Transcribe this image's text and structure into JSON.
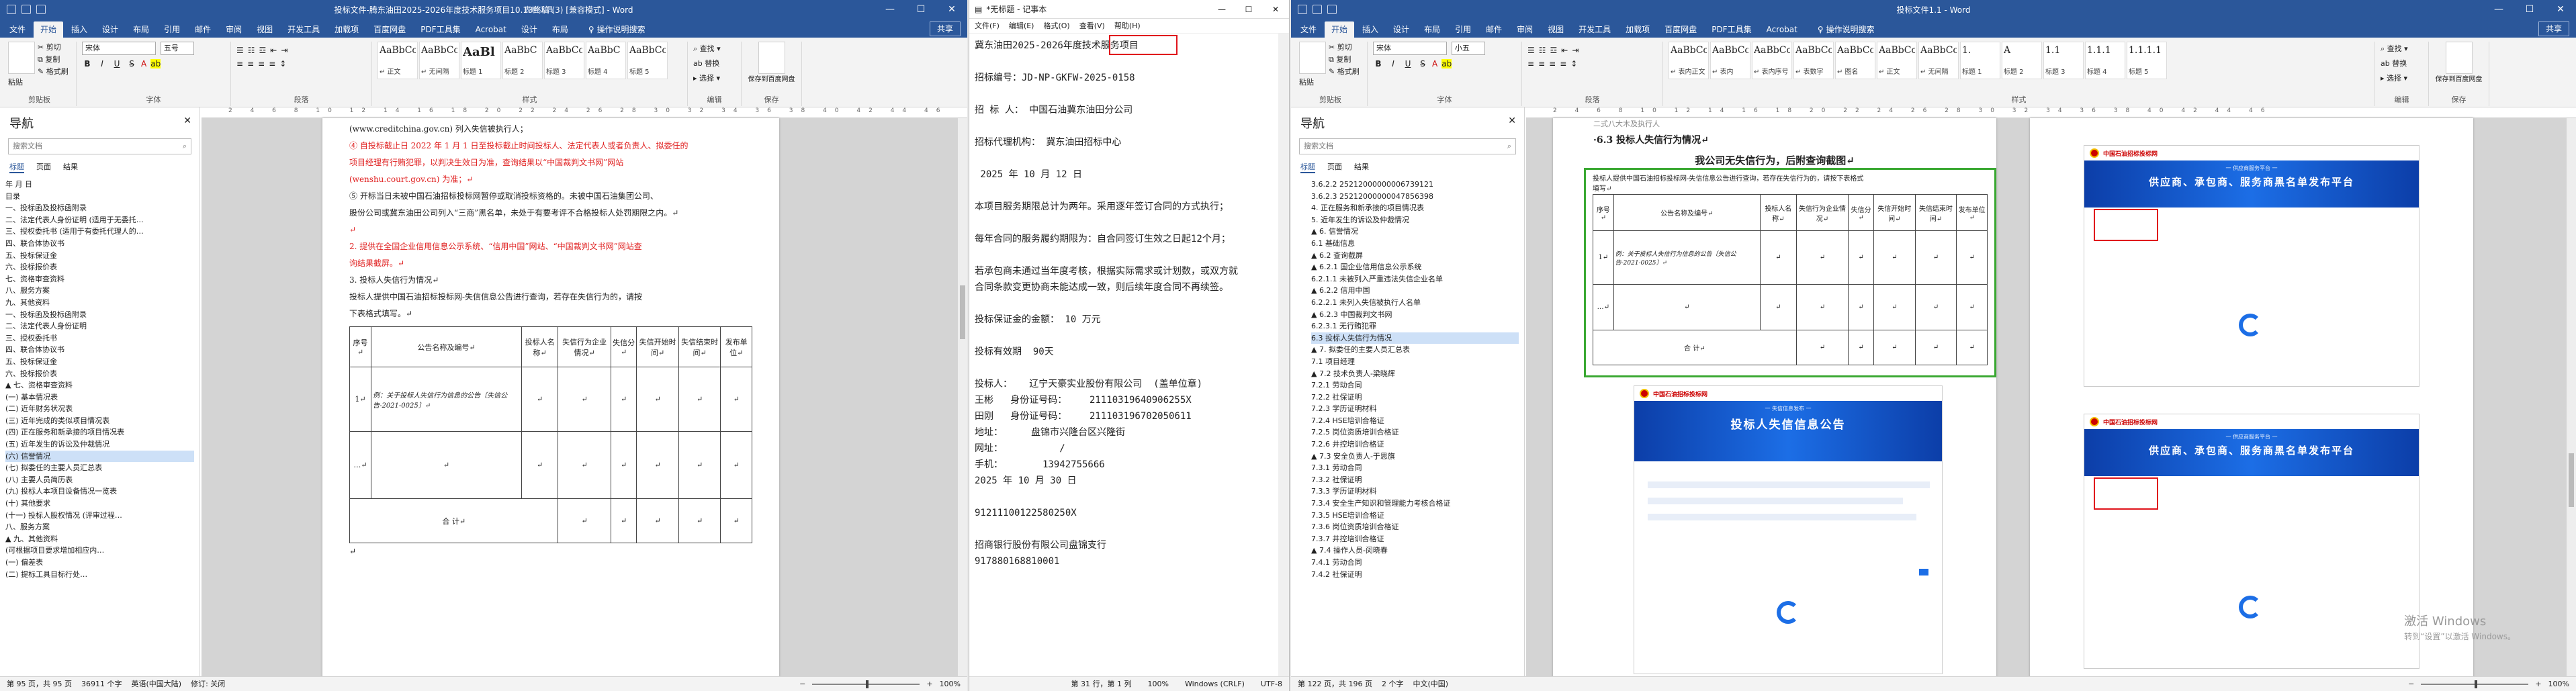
{
  "left_word": {
    "title": "投标文件-腾东油田2025-2026年度技术服务项目10.13终稿 (3) [兼容模式] - Word",
    "tool_context": "表格工具",
    "tabs": [
      "文件",
      "开始",
      "插入",
      "设计",
      "布局",
      "引用",
      "邮件",
      "审阅",
      "视图",
      "开发工具",
      "加载项",
      "百度网盘",
      "PDF工具集",
      "Acrobat",
      "设计",
      "布局"
    ],
    "active_tab": "开始",
    "tell_me": "♀ 操作说明搜索",
    "share": "共享",
    "ribbon": {
      "paste": "粘贴",
      "cut": "✂ 剪切",
      "copy": "⧉ 复制",
      "format_painter": "✎ 格式刷",
      "clipboard_label": "剪贴板",
      "font_name": "宋体",
      "font_size": "五号",
      "font_label": "字体",
      "paragraph_label": "段落",
      "styles_label": "样式",
      "styles": [
        {
          "sample": "AaBbCcDd",
          "name": "↵ 正文"
        },
        {
          "sample": "AaBbCcDd",
          "name": "↵ 无间隔"
        },
        {
          "sample": "AaBl",
          "name": "标题 1"
        },
        {
          "sample": "AaBbC",
          "name": "标题 2"
        },
        {
          "sample": "AaBbCcD",
          "name": "标题 3"
        },
        {
          "sample": "AaBbC",
          "name": "标题 4"
        },
        {
          "sample": "AaBbCcD",
          "name": "标题 5"
        }
      ],
      "find": "⌕ 查找 ▾",
      "replace": "ab 替换",
      "select": "▸ 选择 ▾",
      "editing_label": "编辑",
      "baidu_save": "保存到百度网盘",
      "save_label": "保存"
    },
    "nav": {
      "title": "导航",
      "search_placeholder": "搜索文档",
      "tabs": [
        "标题",
        "页面",
        "结果"
      ],
      "items": [
        "年  月  日",
        "目录",
        "一、投标函及投标函附录",
        "二、法定代表人身份证明 (适用于无委托…",
        "三、授权委托书 (适用于有委托代理人的…",
        "四、联合体协议书",
        "五、投标保证金",
        "六、投标报价表",
        "七、资格审查资料",
        "八、服务方案",
        "九、其他资料",
        "一、投标函及投标函附录",
        "二、法定代表人身份证明",
        "三、授权委托书",
        "四、联合体协议书",
        "五、投标保证金",
        "六、投标报价表",
        "▲ 七、资格审查资料",
        "(一) 基本情况表",
        "(二) 近年财务状况表",
        "(三) 近年完成的类似项目情况表",
        "(四) 正在服务和新承接的项目情况表",
        "(五) 近年发生的诉讼及仲裁情况",
        "(六) 信誉情况",
        "(七) 拟委任的主要人员汇总表",
        "(八) 主要人员简历表",
        "(九) 投标人本项目设备情况一览表",
        "(十) 其他要求",
        "(十一) 投标人股权情况 (评审过程…",
        "八、服务方案",
        "▲ 九、其他资料",
        "(可根据项目要求增加相应内…",
        "(一) 偏差表",
        "(二) 提标工具目标行处…"
      ],
      "selected_index": 23
    },
    "doc": {
      "lines": [
        {
          "t": "(www.creditchina.gov.cn) 列入失信被执行人；",
          "red": false
        },
        {
          "t": "④ 自投标截止日 2022 年 1 月 1 日至投标截止时间投标人、法定代表人或者负责人、拟委任的",
          "red": true
        },
        {
          "t": "项目经理有行贿犯罪，以判决生效日为准，查询结果以“中国裁判文书网”网站",
          "red": true
        },
        {
          "t": "(wenshu.court.gov.cn) 为准；↵",
          "red": true
        },
        {
          "t": "⑤ 开标当日未被中国石油招标投标网暂停或取消投标资格的。未被中国石油集团公司、",
          "red": false
        },
        {
          "t": "股份公司或冀东油田公司列入“三商”黑名单，未处于有要考评不合格投标人处罚期限之内。↵",
          "red": false
        },
        {
          "t": "↵",
          "red": true
        },
        {
          "t": "2. 提供在全国企业信用信息公示系统、“信用中国”网站、“中国裁判文书网”网站查",
          "red": true
        },
        {
          "t": "询结果截屏。↵",
          "red": true
        },
        {
          "t": "3. 投标人失信行为情况↵",
          "red": false
        },
        {
          "t": "投标人提供中国石油招标投标网-失信信息公告进行查询，若存在失信行为的，请按",
          "red": false
        },
        {
          "t": "下表格式填写。↵",
          "red": false
        }
      ],
      "table_headers": [
        "序号↵",
        "公告名称及编号↵",
        "投标人名称↵",
        "失信行为企业情况↵",
        "失信分↵",
        "失信开始时间↵",
        "失信结束时间↵",
        "发布单位↵"
      ],
      "table_row1_no": "1↵",
      "table_row1_example": "例：关于投标人失信行为信息的公告〔失信公告-2021-0025〕↵",
      "table_row2_no": "…↵",
      "table_total": "合      计↵",
      "after": "↵"
    },
    "status": {
      "page": "第 95 页，共 95 页",
      "words": "36911 个字",
      "lang": "英语(中国大陆)",
      "record": "修订: 关闭",
      "zoom": "100%"
    }
  },
  "notepad": {
    "title": "*无标题 - 记事本",
    "menu": [
      "文件(F)",
      "编辑(E)",
      "格式(O)",
      "查看(V)",
      "帮助(H)"
    ],
    "text": "冀东油田2025-2026年度技术服务项目\n\n招标编号：JD-NP-GKFW-2025-0158\n\n招 标 人： 中国石油冀东油田分公司\n\n招标代理机构： 冀东油田招标中心\n\n 2025 年 10 月 12 日\n\n本项目服务期限总计为两年。采用逐年签订合同的方式执行；\n\n每年合同的服务履约期限为：自合同签订生效之日起12个月；\n\n若承包商未通过当年度考核，根据实际需求或计划数，或双方就\n合同条款变更协商未能达成一致，则后续年度合同不再续签。\n\n投标保证金的金额： 10 万元\n\n投标有效期  90天\n\n投标人：   辽宁天豪实业股份有限公司  (盖单位章)\n王彬   身份证号码：    211103196409062​55X\n田刚   身份证号码：    211103196702050611\n地址：     盘锦市兴隆台区兴隆街\n网址：          /\n手机：       13942755666\n2025 年 10 月 30 日\n\n91211100122580250X\n\n招商银行股份有限公司盘锦支行\n917880168810001",
    "status": {
      "pos": "第 31 行，第 1 列",
      "zoom": "100%",
      "eol": "Windows (CRLF)",
      "enc": "UTF-8"
    }
  },
  "right_word": {
    "title": "投标文件1.1 - Word",
    "tabs": [
      "文件",
      "开始",
      "插入",
      "设计",
      "布局",
      "引用",
      "邮件",
      "审阅",
      "视图",
      "开发工具",
      "加载项",
      "百度网盘",
      "PDF工具集",
      "Acrobat"
    ],
    "active_tab": "开始",
    "tell_me": "♀ 操作说明搜索",
    "share": "共享",
    "ribbon": {
      "paste": "粘贴",
      "cut": "✂ 剪切",
      "copy": "⧉ 复制",
      "format_painter": "✎ 格式刷",
      "clipboard_label": "剪贴板",
      "font_name": "宋体",
      "font_size": "小五",
      "font_label": "字体",
      "paragraph_label": "段落",
      "styles_label": "样式",
      "styles": [
        {
          "sample": "AaBbCcDd",
          "name": "↵ 表内正文"
        },
        {
          "sample": "AaBbCcDd",
          "name": "↵ 表内"
        },
        {
          "sample": "AaBbCcDd",
          "name": "↵ 表内序号"
        },
        {
          "sample": "AaBbCcDd",
          "name": "↵ 表数字"
        },
        {
          "sample": "AaBbCcDd",
          "name": "↵ 图名"
        },
        {
          "sample": "AaBbCcDd",
          "name": "↵ 正文"
        },
        {
          "sample": "AaBbCcDd",
          "name": "↵ 无间隔"
        },
        {
          "sample": "1.",
          "name": "标题 1"
        },
        {
          "sample": "A",
          "name": "标题 2"
        },
        {
          "sample": "1.1",
          "name": "标题 3"
        },
        {
          "sample": "1.1.1",
          "name": "标题 4"
        },
        {
          "sample": "1.1.1.1",
          "name": "标题 5"
        }
      ],
      "find": "⌕ 查找 ▾",
      "replace": "ab 替换",
      "select": "▸ 选择 ▾",
      "editing_label": "编辑",
      "baidu_save": "保存到百度网盘",
      "save_label": "保存"
    },
    "nav": {
      "title": "导航",
      "search_placeholder": "搜索文档",
      "tabs": [
        "标题",
        "页面",
        "结果"
      ],
      "items": [
        "3.6.2.2 25212000000006739121",
        "3.6.2.3 25212000000047856398",
        "4. 正在服务和新承接的项目情况表",
        "5. 近年发生的诉讼及仲裁情况",
        "▲ 6. 信誉情况",
        "6.1 基础信息",
        "▲ 6.2 查询截屏",
        "▲ 6.2.1 国企业信用信息公示系统",
        "6.2.1.1 未被列入严重违法失信企业名单",
        "▲ 6.2.2 信用中国",
        "6.2.2.1 未列入失信被执行人名单",
        "▲ 6.2.3 中国裁判文书网",
        "6.2.3.1 无行贿犯罪",
        "6.3 投标人失信行为情况",
        "▲ 7. 拟委任的主要人员汇总表",
        "7.1 项目经理",
        "▲ 7.2 技术负责人-梁晓辉",
        "7.2.1 劳动合同",
        "7.2.2 社保证明",
        "7.2.3 学历证明材料",
        "7.2.4 HSE培训合格证",
        "7.2.5 岗位资质培训合格证",
        "7.2.6 井控培训合格证",
        "▲ 7.3 安全负责人-于思旗",
        "7.3.1 劳动合同",
        "7.3.2 社保证明",
        "7.3.3 学历证明材料",
        "7.3.4 安全生产知识和管理能力考核合格证",
        "7.3.5 HSE培训合格证",
        "7.3.6 岗位资质培训合格证",
        "7.3.7 井控培训合格证",
        "▲ 7.4 操作人员-闵晓春",
        "7.4.1 劳动合同",
        "7.4.2 社保证明"
      ],
      "selected_index": 13
    },
    "doc": {
      "prev_heading": "二式八大木及执行人",
      "heading": "·6.3    投标人失信行为情况↵",
      "subheading": "我公司无失信行为，后附查询截图↵",
      "para1": "投标人提供中国石油招标投标网-失信信息公告进行查询，若存在失信行为的，请按下表格式",
      "para2": "填写↵",
      "table_headers": [
        "序号↵",
        "公告名称及编号↵",
        "投标人名称↵",
        "失信行为企业情况↵",
        "失信分↵",
        "失信开始时间↵",
        "失信结束时间↵",
        "发布单位↵"
      ],
      "table_row1_no": "1↵",
      "table_row1_example": "例：关于投标人失信行为信息的公告〔失信公告-2021-0025〕↵",
      "table_row2_no": "…↵",
      "table_total": "合      计↵",
      "site_name": "中国石油招标投标网",
      "portal_sub": "一 供应商服务平台 一",
      "portal_title": "供应商、承包商、服务商黑名单发布平台",
      "notice_sub": "一 失信信息发布 一",
      "notice_title": "投标人失信信息公告"
    },
    "status": {
      "page": "第 122 页，共 196 页",
      "words": "2 个字",
      "lang": "中文(中国)",
      "zoom": "100%"
    },
    "watermark_title": "激活 Windows",
    "watermark_sub": "转到“设置”以激活 Windows。"
  }
}
